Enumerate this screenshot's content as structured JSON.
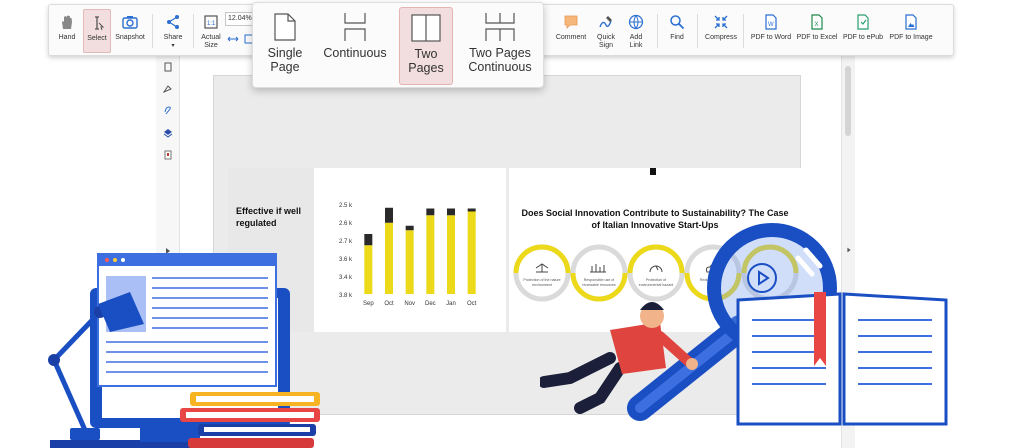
{
  "toolbar": {
    "hand": "Hand",
    "select": "Select",
    "snapshot": "Snapshot",
    "share": "Share",
    "actual_size": "Actual Size",
    "zoom_value": "12.04%",
    "partial_label": "t",
    "comment": "Comment",
    "quick_sign": "Quick Sign",
    "add_link": "Add Link",
    "find": "Find",
    "compress": "Compress",
    "pdf_to_word": "PDF to Word",
    "pdf_to_excel": "PDF to Excel",
    "pdf_to_epub": "PDF to ePub",
    "pdf_to_image": "PDF to Image"
  },
  "view_modes": [
    {
      "label": "Single Page",
      "active": false
    },
    {
      "label": "Continuous",
      "active": false
    },
    {
      "label": "Two Pages",
      "active": true
    },
    {
      "label": "Two Pages Continuous",
      "active": false
    }
  ],
  "document": {
    "left_slide_heading": "Effective if well regulated",
    "right_slide_title": "Does Social Innovation Contribute to Sustainability? The Case of Italian Innovative Start-Ups",
    "ring_labels": [
      "Protection of the nature environment",
      "Responsible use of renewable resources",
      "Protection of environmental hazard",
      "Reduction of",
      ""
    ]
  },
  "colors": {
    "accent_red": "#c0392b",
    "active_bg": "#f2dede",
    "bar_yellow": "#ecd91a",
    "bar_dark": "#2a2a2a",
    "ring_yellow": "#ecd91a",
    "ring_gray": "#dadada",
    "illustration_blue": "#1a4fc4"
  },
  "chart_data": {
    "type": "bar",
    "categories": [
      "Sep",
      "Oct",
      "Nov",
      "Dec",
      "Jan",
      "Oct"
    ],
    "series": [
      {
        "values": [
          3.65,
          3.95,
          3.85,
          4.05,
          4.05,
          4.1
        ]
      },
      {
        "values": [
          0.15,
          0.2,
          0.06,
          0.09,
          0.09,
          0.04
        ]
      }
    ],
    "yticks": [
      "2.5 k",
      "2.6 k",
      "2.7 k",
      "3.6 k",
      "3.4 k",
      "3.8 k"
    ],
    "ylim": [
      3.0,
      4.2
    ]
  }
}
